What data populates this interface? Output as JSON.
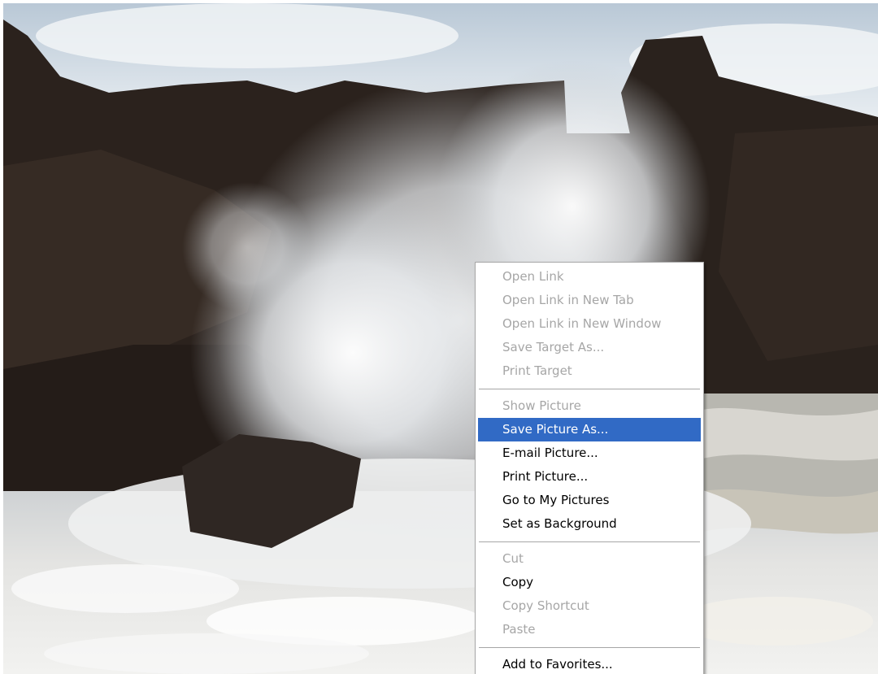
{
  "context_menu": {
    "groups": [
      [
        {
          "label": "Open Link",
          "enabled": false
        },
        {
          "label": "Open Link in New Tab",
          "enabled": false
        },
        {
          "label": "Open Link in New Window",
          "enabled": false
        },
        {
          "label": "Save Target As...",
          "enabled": false
        },
        {
          "label": "Print Target",
          "enabled": false
        }
      ],
      [
        {
          "label": "Show Picture",
          "enabled": false
        },
        {
          "label": "Save Picture As...",
          "enabled": true,
          "selected": true
        },
        {
          "label": "E-mail Picture...",
          "enabled": true
        },
        {
          "label": "Print Picture...",
          "enabled": true
        },
        {
          "label": "Go to My Pictures",
          "enabled": true
        },
        {
          "label": "Set as Background",
          "enabled": true
        }
      ],
      [
        {
          "label": "Cut",
          "enabled": false
        },
        {
          "label": "Copy",
          "enabled": true
        },
        {
          "label": "Copy Shortcut",
          "enabled": false
        },
        {
          "label": "Paste",
          "enabled": false
        }
      ],
      [
        {
          "label": "Add to Favorites...",
          "enabled": true
        }
      ]
    ]
  },
  "colors": {
    "selection": "#316ac5",
    "disabled_text": "#a6a6a6",
    "menu_background": "#ffffff"
  }
}
